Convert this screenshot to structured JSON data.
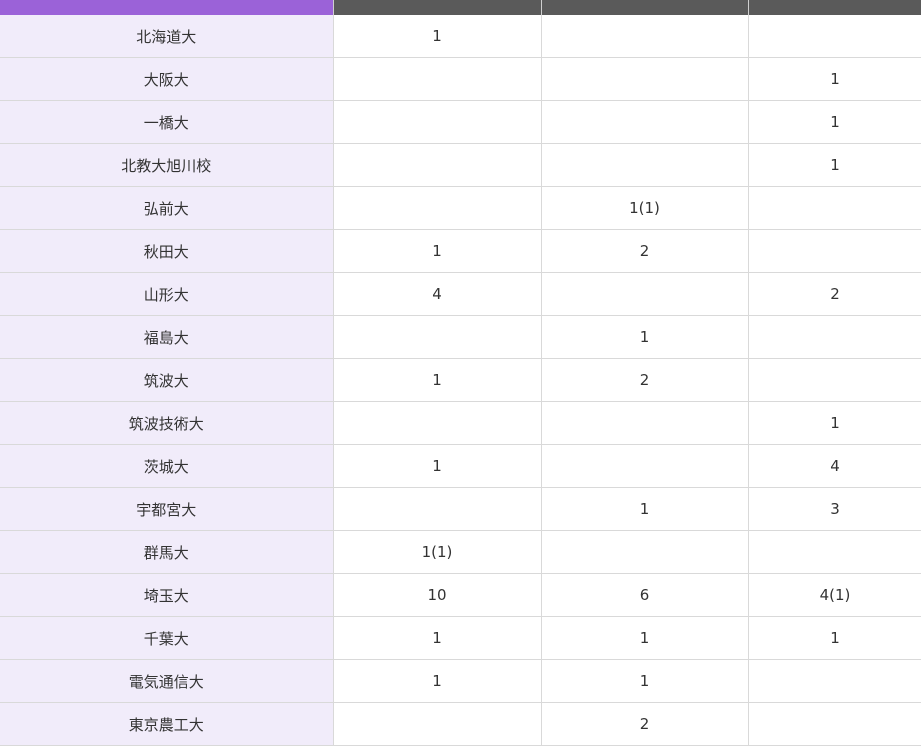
{
  "table": {
    "headers": [
      "",
      "",
      "",
      ""
    ],
    "rows": [
      {
        "name": "北海道大",
        "v1": "1",
        "v2": "",
        "v3": ""
      },
      {
        "name": "大阪大",
        "v1": "",
        "v2": "",
        "v3": "1"
      },
      {
        "name": "一橋大",
        "v1": "",
        "v2": "",
        "v3": "1"
      },
      {
        "name": "北教大旭川校",
        "v1": "",
        "v2": "",
        "v3": "1"
      },
      {
        "name": "弘前大",
        "v1": "",
        "v2": "1(1)",
        "v3": ""
      },
      {
        "name": "秋田大",
        "v1": "1",
        "v2": "2",
        "v3": ""
      },
      {
        "name": "山形大",
        "v1": "4",
        "v2": "",
        "v3": "2"
      },
      {
        "name": "福島大",
        "v1": "",
        "v2": "1",
        "v3": ""
      },
      {
        "name": "筑波大",
        "v1": "1",
        "v2": "2",
        "v3": ""
      },
      {
        "name": "筑波技術大",
        "v1": "",
        "v2": "",
        "v3": "1"
      },
      {
        "name": "茨城大",
        "v1": "1",
        "v2": "",
        "v3": "4"
      },
      {
        "name": "宇都宮大",
        "v1": "",
        "v2": "1",
        "v3": "3"
      },
      {
        "name": "群馬大",
        "v1": "1(1)",
        "v2": "",
        "v3": ""
      },
      {
        "name": "埼玉大",
        "v1": "10",
        "v2": "6",
        "v3": "4(1)"
      },
      {
        "name": "千葉大",
        "v1": "1",
        "v2": "1",
        "v3": "1"
      },
      {
        "name": "電気通信大",
        "v1": "1",
        "v2": "1",
        "v3": ""
      },
      {
        "name": "東京農工大",
        "v1": "",
        "v2": "2",
        "v3": ""
      }
    ]
  },
  "colors": {
    "header_first": "#9b62d8",
    "header_other": "#5a5a5a",
    "name_cell_bg": "#f1ecfa",
    "grid": "#d9d9d9"
  }
}
